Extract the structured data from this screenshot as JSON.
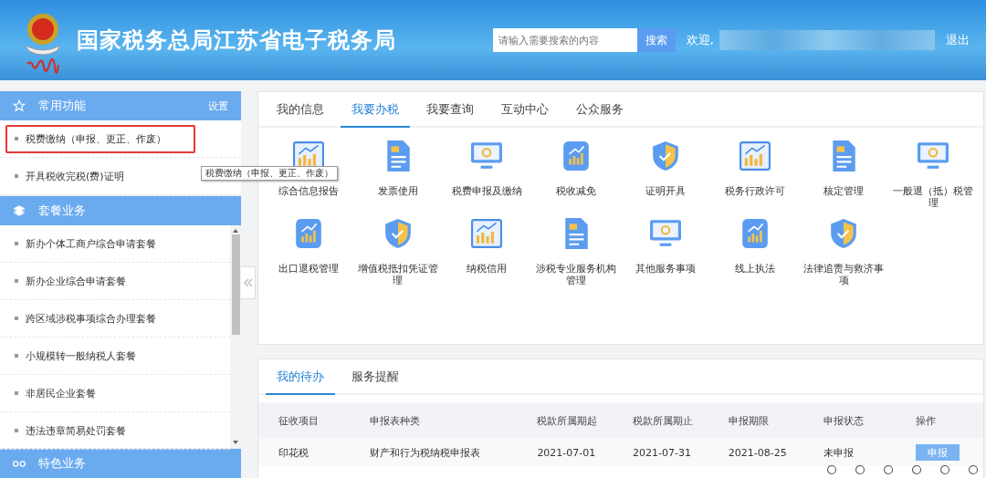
{
  "header": {
    "title": "国家税务总局江苏省电子税务局",
    "search": {
      "placeholder": "请输入需要搜索的内容",
      "button": "搜索"
    },
    "welcome": "欢迎,",
    "logout": "退出"
  },
  "sidebar": {
    "sections": [
      {
        "title": "常用功能",
        "action": "设置",
        "items": [
          {
            "label": "税费缴纳（申报、更正、作废）",
            "highlighted": true
          },
          {
            "label": "开具税收完税(费)证明",
            "highlighted": false
          }
        ]
      },
      {
        "title": "套餐业务",
        "scrollable": true,
        "items": [
          {
            "label": "新办个体工商户综合申请套餐",
            "highlighted": false
          },
          {
            "label": "新办企业综合申请套餐",
            "highlighted": false
          },
          {
            "label": "跨区域涉税事项综合办理套餐",
            "highlighted": false
          },
          {
            "label": "小规模转一般纳税人套餐",
            "highlighted": false
          },
          {
            "label": "非居民企业套餐",
            "highlighted": false
          },
          {
            "label": "违法违章简易处罚套餐",
            "highlighted": false
          }
        ]
      },
      {
        "title": "特色业务"
      }
    ]
  },
  "tooltip": "税费缴纳（申报、更正、作废）",
  "main": {
    "tabs": [
      {
        "label": "我的信息",
        "selected": false
      },
      {
        "label": "我要办税",
        "selected": true
      },
      {
        "label": "我要查询",
        "selected": false
      },
      {
        "label": "互动中心",
        "selected": false
      },
      {
        "label": "公众服务",
        "selected": false
      }
    ],
    "services": [
      {
        "label": "综合信息报告"
      },
      {
        "label": "发票使用"
      },
      {
        "label": "税费申报及缴纳"
      },
      {
        "label": "税收减免"
      },
      {
        "label": "证明开具"
      },
      {
        "label": "税务行政许可"
      },
      {
        "label": "核定管理"
      },
      {
        "label": "一般退（抵）税管理"
      },
      {
        "label": "出口退税管理"
      },
      {
        "label": "增值税抵扣凭证管理"
      },
      {
        "label": "纳税信用"
      },
      {
        "label": "涉税专业服务机构管理"
      },
      {
        "label": "其他服务事项"
      },
      {
        "label": "线上执法"
      },
      {
        "label": "法律追责与救济事项"
      }
    ]
  },
  "todo": {
    "tabs": [
      {
        "label": "我的待办",
        "selected": true
      },
      {
        "label": "服务提醒",
        "selected": false
      }
    ],
    "columns": [
      "征收项目",
      "申报表种类",
      "税款所属期起",
      "税款所属期止",
      "申报期限",
      "申报状态",
      "操作"
    ],
    "rows": [
      {
        "cells": [
          "印花税",
          "财产和行为税纳税申报表",
          "2021-07-01",
          "2021-07-31",
          "2021-08-25",
          "未申报"
        ],
        "action": "申报"
      }
    ]
  }
}
